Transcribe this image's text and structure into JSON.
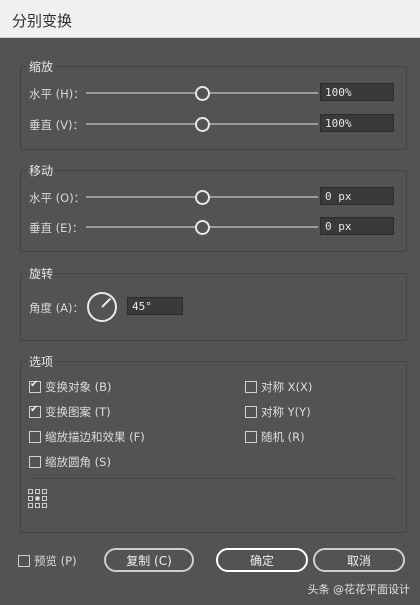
{
  "title": "分别变换",
  "scale": {
    "legend": "缩放",
    "horizontal_label": "水平 (H)：",
    "horizontal_value": "100%",
    "horizontal_slider": 0.5,
    "vertical_label": "垂直 (V)：",
    "vertical_value": "100%",
    "vertical_slider": 0.5
  },
  "move": {
    "legend": "移动",
    "horizontal_label": "水平 (O)：",
    "horizontal_value": "0 px",
    "horizontal_slider": 0.5,
    "vertical_label": "垂直 (E)：",
    "vertical_value": "0 px",
    "vertical_slider": 0.5
  },
  "rotate": {
    "legend": "旋转",
    "angle_label": "角度 (A)：",
    "angle_value": "45°",
    "angle_degrees": 45
  },
  "options": {
    "legend": "选项",
    "transform_objects": {
      "label": "变换对象 (B)",
      "checked": true
    },
    "transform_patterns": {
      "label": "变换图案 (T)",
      "checked": true
    },
    "scale_strokes": {
      "label": "缩放描边和效果 (F)",
      "checked": false
    },
    "scale_corners": {
      "label": "缩放圆角 (S)",
      "checked": false
    },
    "reflect_x": {
      "label": "对称 X(X)",
      "checked": false
    },
    "reflect_y": {
      "label": "对称 Y(Y)",
      "checked": false
    },
    "random": {
      "label": "随机 (R)",
      "checked": false
    },
    "reference_point_icon": "reference-point-grid"
  },
  "footer": {
    "preview": {
      "label": "预览 (P)",
      "checked": false
    },
    "copy_label": "复制 (C)",
    "ok_label": "确定",
    "cancel_label": "取消"
  },
  "watermark": "头条 @花花平面设计"
}
